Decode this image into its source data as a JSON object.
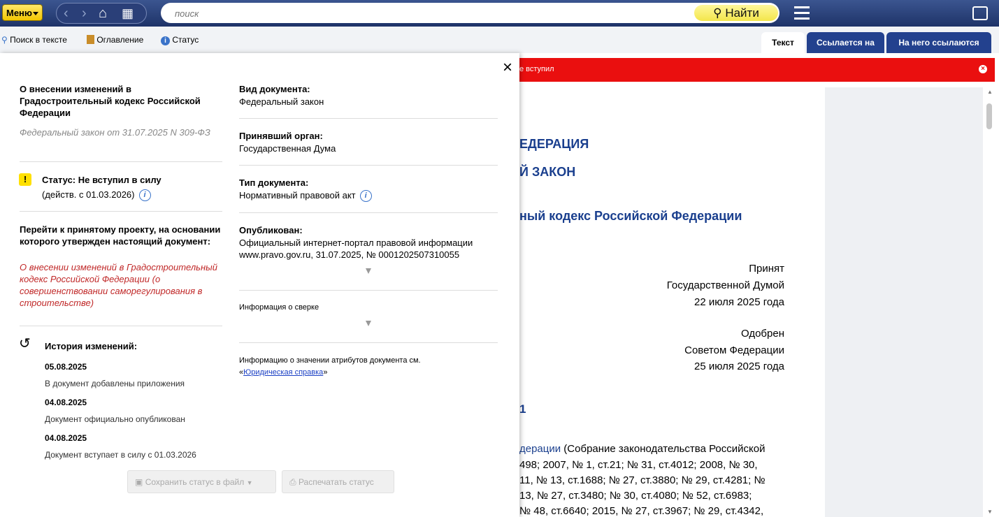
{
  "topbar": {
    "menu_label": "Меню",
    "search_placeholder": "поиск",
    "find_label": "Найти"
  },
  "toolbar": {
    "search_in_text": "Поиск в тексте",
    "contents": "Оглавление",
    "status": "Статус"
  },
  "tabs": [
    "Текст",
    "Ссылается на",
    "На него ссылаются"
  ],
  "colors": {
    "accent_red": "#ea0f0f",
    "header_blue": "#1e3368",
    "link_red": "#c02828"
  },
  "banner": {
    "text": "е вступил"
  },
  "document": {
    "heading1": "ЕДЕРАЦИЯ",
    "heading2": "Й ЗАКОН",
    "title": "ный кодекс Российской Федерации",
    "accepted": [
      "Принят",
      "Государственной Думой",
      "22 июля 2025 года"
    ],
    "approved": [
      "Одобрен",
      "Советом Федерации",
      "25 июля 2025 года"
    ],
    "article": "1",
    "body_first_link": "дерации",
    "body_lines": [
      " (Собрание законодательства Российской",
      "498; 2007, № 1, ст.21; № 31, ст.4012; 2008, № 30,",
      "11, № 13, ст.1688; № 27, ст.3880; № 29, ст.4281; №",
      "13, № 27, ст.3480; № 30, ст.4080; № 52, ст.6983;",
      "№ 48, ст.6640; 2015, № 27, ст.3967; № 29, ст.4342,"
    ]
  },
  "panel": {
    "doc_title": "О внесении изменений в Градостроительный кодекс Российской Федерации",
    "doc_subtitle": "Федеральный закон от 31.07.2025 N 309-ФЗ",
    "status_label": "Статус: Не вступил в силу",
    "status_effective": "(действ. с 01.03.2026)",
    "project_label": "Перейти к принятому проекту, на основании которого утвержден настоящий документ:",
    "project_link": "О внесении изменений в Градостроительный кодекс Российской Федерации (о совершенствовании саморегулирования в строительстве)",
    "history_title": "История изменений:",
    "history": [
      {
        "date": "05.08.2025",
        "text": "В документ добавлены приложения"
      },
      {
        "date": "04.08.2025",
        "text": "Документ официально опубликован"
      },
      {
        "date": "04.08.2025",
        "text": "Документ вступает в силу с 01.03.2026"
      }
    ],
    "doc_kind_label": "Вид документа:",
    "doc_kind": "Федеральный закон",
    "organ_label": "Принявший орган:",
    "organ": "Государственная Дума",
    "type_label": "Тип документа:",
    "type": "Нормативный правовой акт",
    "published_label": "Опубликован:",
    "published": "Официальный интернет-портал правовой информации www.pravo.gov.ru, 31.07.2025, № 0001202507310055",
    "reconcile": "Информация о сверке",
    "attr_info": "Информацию о значении атрибутов документа см.",
    "attr_link": "Юридическая справка",
    "save_button": "Сохранить статус в файл",
    "print_button": "Распечатать статус"
  }
}
